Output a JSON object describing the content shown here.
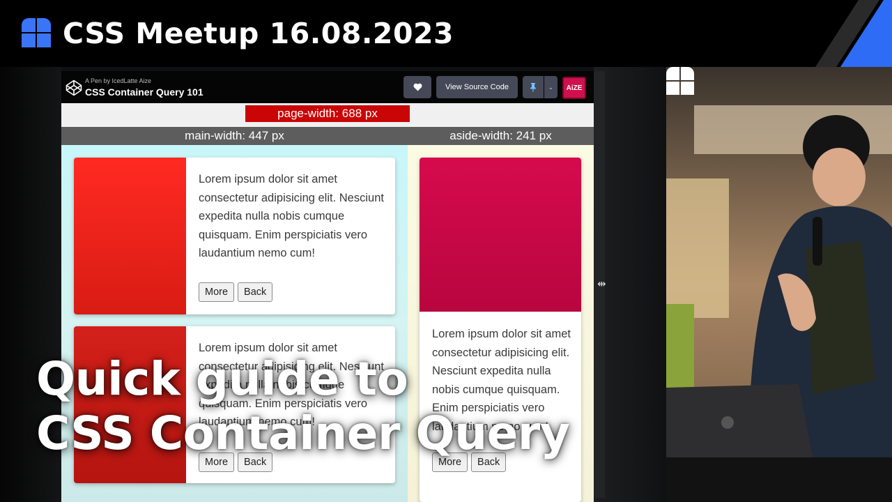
{
  "banner": {
    "title": "CSS Meetup 16.08.2023",
    "logo_icon": "meetup-logo-icon",
    "accent_color": "#2f6cf6"
  },
  "codepen": {
    "byline": "A Pen by IcedLatte Aize",
    "pen_title": "CSS Container Query 101",
    "heart_icon": "heart-icon",
    "view_source_label": "View Source Code",
    "pin_icon": "pin-icon",
    "dropdown_icon": "chevron-down-icon",
    "avatar_label": "AiZE"
  },
  "demo": {
    "page_width_label": "page-width: 688 px",
    "main_width_label": "main-width: 447 px",
    "aside_width_label": "aside-width: 241 px",
    "cards": [
      {
        "text": "Lorem ipsum dolor sit amet consectetur adipisicing elit. Nesciunt expedita nulla nobis cumque quisquam. Enim perspiciatis vero laudantium nemo cum!",
        "more_label": "More",
        "back_label": "Back",
        "image_color": "#ff2a22"
      },
      {
        "text": "Lorem ipsum dolor sit amet consectetur adipisicing elit. Nesciunt expedita nulla nobis cumque quisquam. Enim perspiciatis vero laudantium nemo cum!",
        "more_label": "More",
        "back_label": "Back",
        "image_color": "#d4201a"
      },
      {
        "text": "Lorem ipsum dolor sit amet consectetur adipisicing elit. Nesciunt expedita nulla nobis cumque quisquam. Enim perspiciatis vero laudantium nemo cum!",
        "more_label": "More",
        "back_label": "Back",
        "image_color": "#d60a4d"
      }
    ]
  },
  "headline": {
    "line1": "Quick guide to",
    "line2": "CSS Container Query"
  }
}
